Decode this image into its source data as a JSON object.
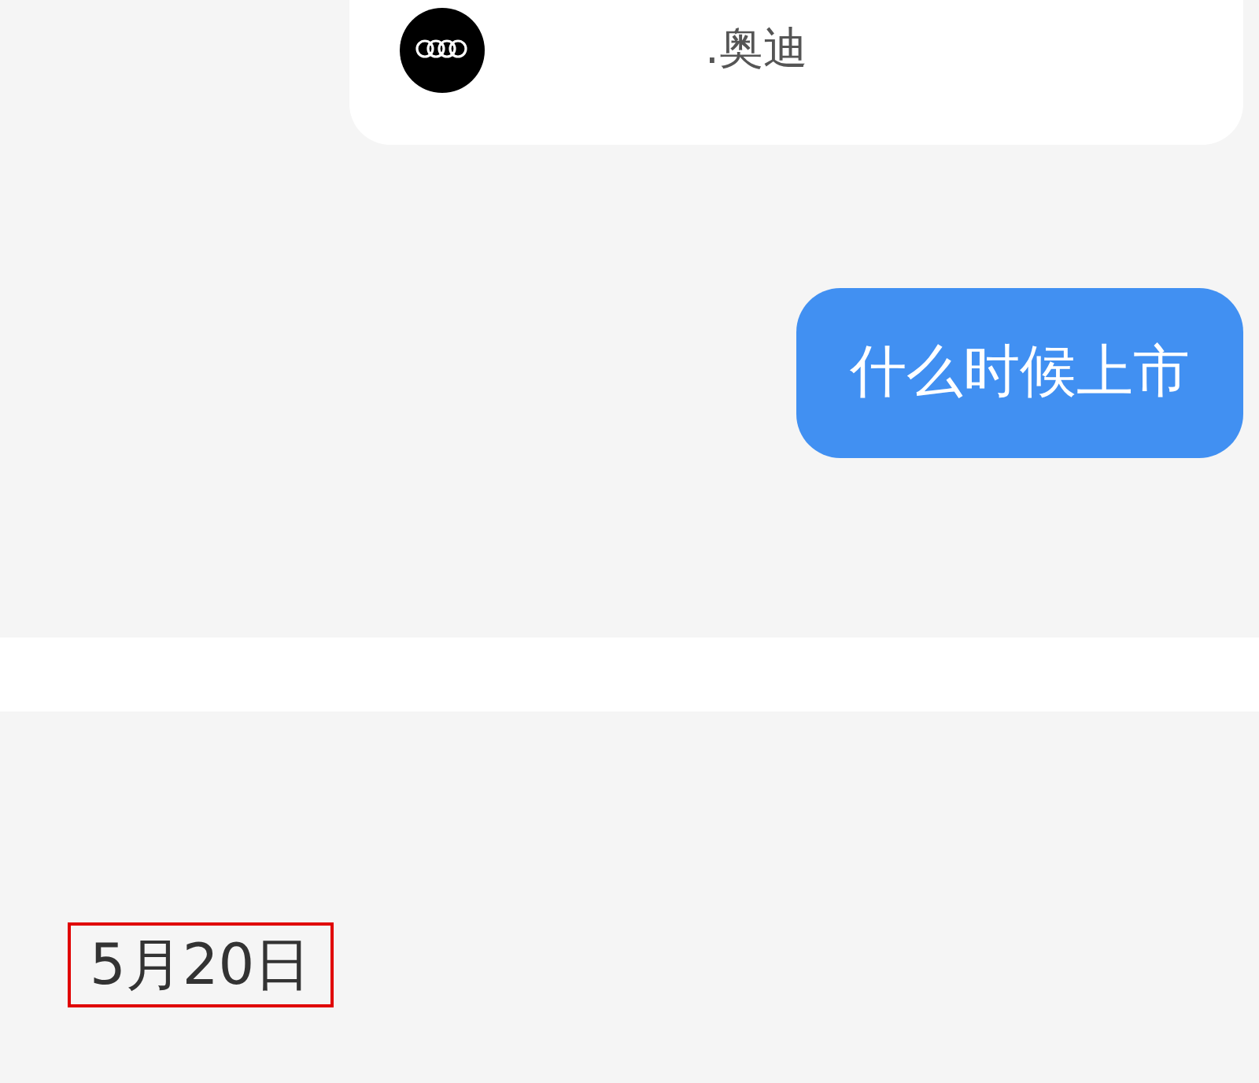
{
  "brand_card": {
    "name": ".奥迪"
  },
  "messages": [
    {
      "kind": "sent",
      "text": "什么时候上市"
    }
  ],
  "date": {
    "text": "5月20日",
    "highlighted": true
  }
}
